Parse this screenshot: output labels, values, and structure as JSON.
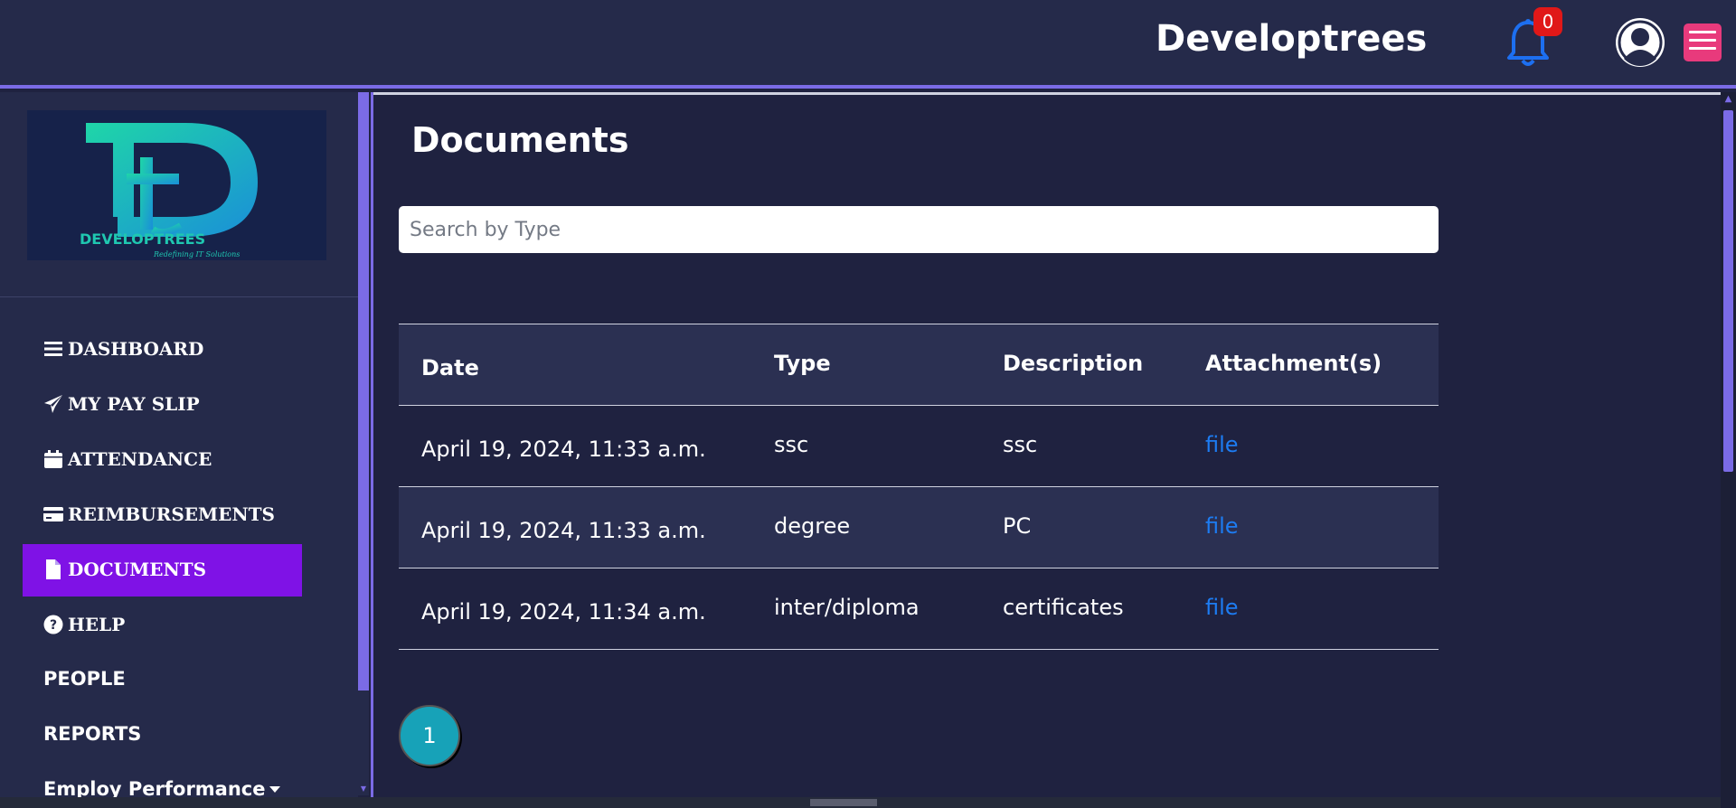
{
  "header": {
    "brand": "Developtrees",
    "notification_count": "0"
  },
  "sidebar": {
    "logo": {
      "text": "DEVELOPTREES",
      "tagline": "Redefining IT Solutions"
    },
    "items": [
      {
        "label": "DASHBOARD",
        "icon": "bars-icon"
      },
      {
        "label": "MY PAY SLIP",
        "icon": "paper-plane-icon"
      },
      {
        "label": "ATTENDANCE",
        "icon": "calendar-icon"
      },
      {
        "label": "REIMBURSEMENTS",
        "icon": "credit-card-icon"
      },
      {
        "label": "DOCUMENTS",
        "icon": "file-icon",
        "active": true
      },
      {
        "label": "HELP",
        "icon": "question-circle-icon"
      },
      {
        "label": "PEOPLE"
      },
      {
        "label": "REPORTS"
      },
      {
        "label": "Employ Performance"
      }
    ]
  },
  "main": {
    "title": "Documents",
    "search": {
      "placeholder": "Search by Type",
      "value": ""
    },
    "table": {
      "headers": [
        "Date",
        "Type",
        "Description",
        "Attachment(s)"
      ],
      "rows": [
        [
          "April 19, 2024, 11:33 a.m.",
          "ssc",
          "ssc",
          "file"
        ],
        [
          "April 19, 2024, 11:33 a.m.",
          "degree",
          "PC",
          "file"
        ],
        [
          "April 19, 2024, 11:34 a.m.",
          "inter/diploma",
          "certificates",
          "file"
        ]
      ]
    },
    "pagination": {
      "current_page": "1"
    }
  },
  "colors": {
    "background": "#1f2240",
    "topbar": "#252a4a",
    "accent": "#7b6be6",
    "active_nav": "#7f12e6",
    "link": "#1d7cf2",
    "badge": "#e01818",
    "menu_button": "#e83a7c",
    "pagination": "#17a2b8"
  }
}
